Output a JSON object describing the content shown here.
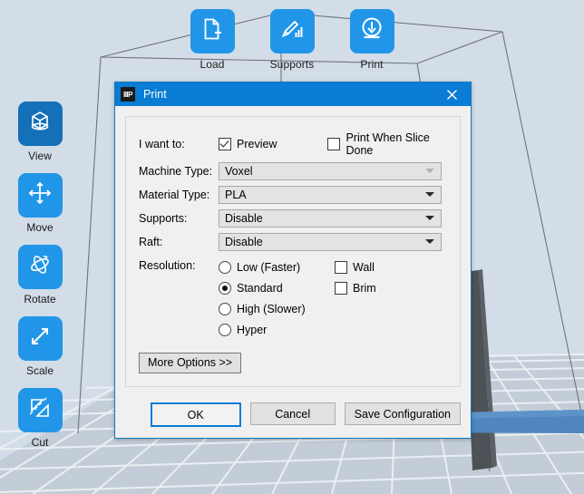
{
  "app": {
    "viewport_background": "#d3dde7",
    "plate_color": "#c2ccd6",
    "grid_color": "#f2f5f8",
    "accent": "#2196e8",
    "accent_dark": "#1470b8",
    "title_bar_color": "#0a7cd4"
  },
  "top_toolbar": {
    "items": [
      {
        "label": "Load",
        "icon": "file-plus-icon"
      },
      {
        "label": "Supports",
        "icon": "pencil-supports-icon"
      },
      {
        "label": "Print",
        "icon": "print-down-arrow-icon"
      }
    ]
  },
  "left_toolbar": {
    "items": [
      {
        "label": "View",
        "icon": "cube-view-icon",
        "active": true
      },
      {
        "label": "Move",
        "icon": "four-arrows-move-icon",
        "active": false
      },
      {
        "label": "Rotate",
        "icon": "rotate-orbit-icon",
        "active": false
      },
      {
        "label": "Scale",
        "icon": "scale-diagonal-arrows-icon",
        "active": false
      },
      {
        "label": "Cut",
        "icon": "cut-plane-icon",
        "active": false
      }
    ]
  },
  "dialog": {
    "title": "Print",
    "app_icon_text": "IIIP",
    "close_icon": "close-icon",
    "rows": {
      "i_want_to": {
        "label": "I want to:",
        "preview": {
          "label": "Preview",
          "checked": true
        },
        "print_when_slice_done": {
          "label": "Print When Slice Done",
          "checked": false
        }
      },
      "machine_type": {
        "label": "Machine Type:",
        "value": "Voxel",
        "disabled": true
      },
      "material_type": {
        "label": "Material Type:",
        "value": "PLA",
        "disabled": false
      },
      "supports": {
        "label": "Supports:",
        "value": "Disable",
        "disabled": false
      },
      "raft": {
        "label": "Raft:",
        "value": "Disable",
        "disabled": false
      },
      "resolution": {
        "label": "Resolution:",
        "options": [
          {
            "label": "Low (Faster)",
            "selected": false
          },
          {
            "label": "Standard",
            "selected": true
          },
          {
            "label": "High (Slower)",
            "selected": false
          },
          {
            "label": "Hyper",
            "selected": false
          }
        ],
        "extras": [
          {
            "label": "Wall",
            "checked": false
          },
          {
            "label": "Brim",
            "checked": false
          }
        ]
      }
    },
    "more_options_label": "More Options >>",
    "footer": {
      "ok": "OK",
      "cancel": "Cancel",
      "save_configuration": "Save Configuration"
    }
  }
}
